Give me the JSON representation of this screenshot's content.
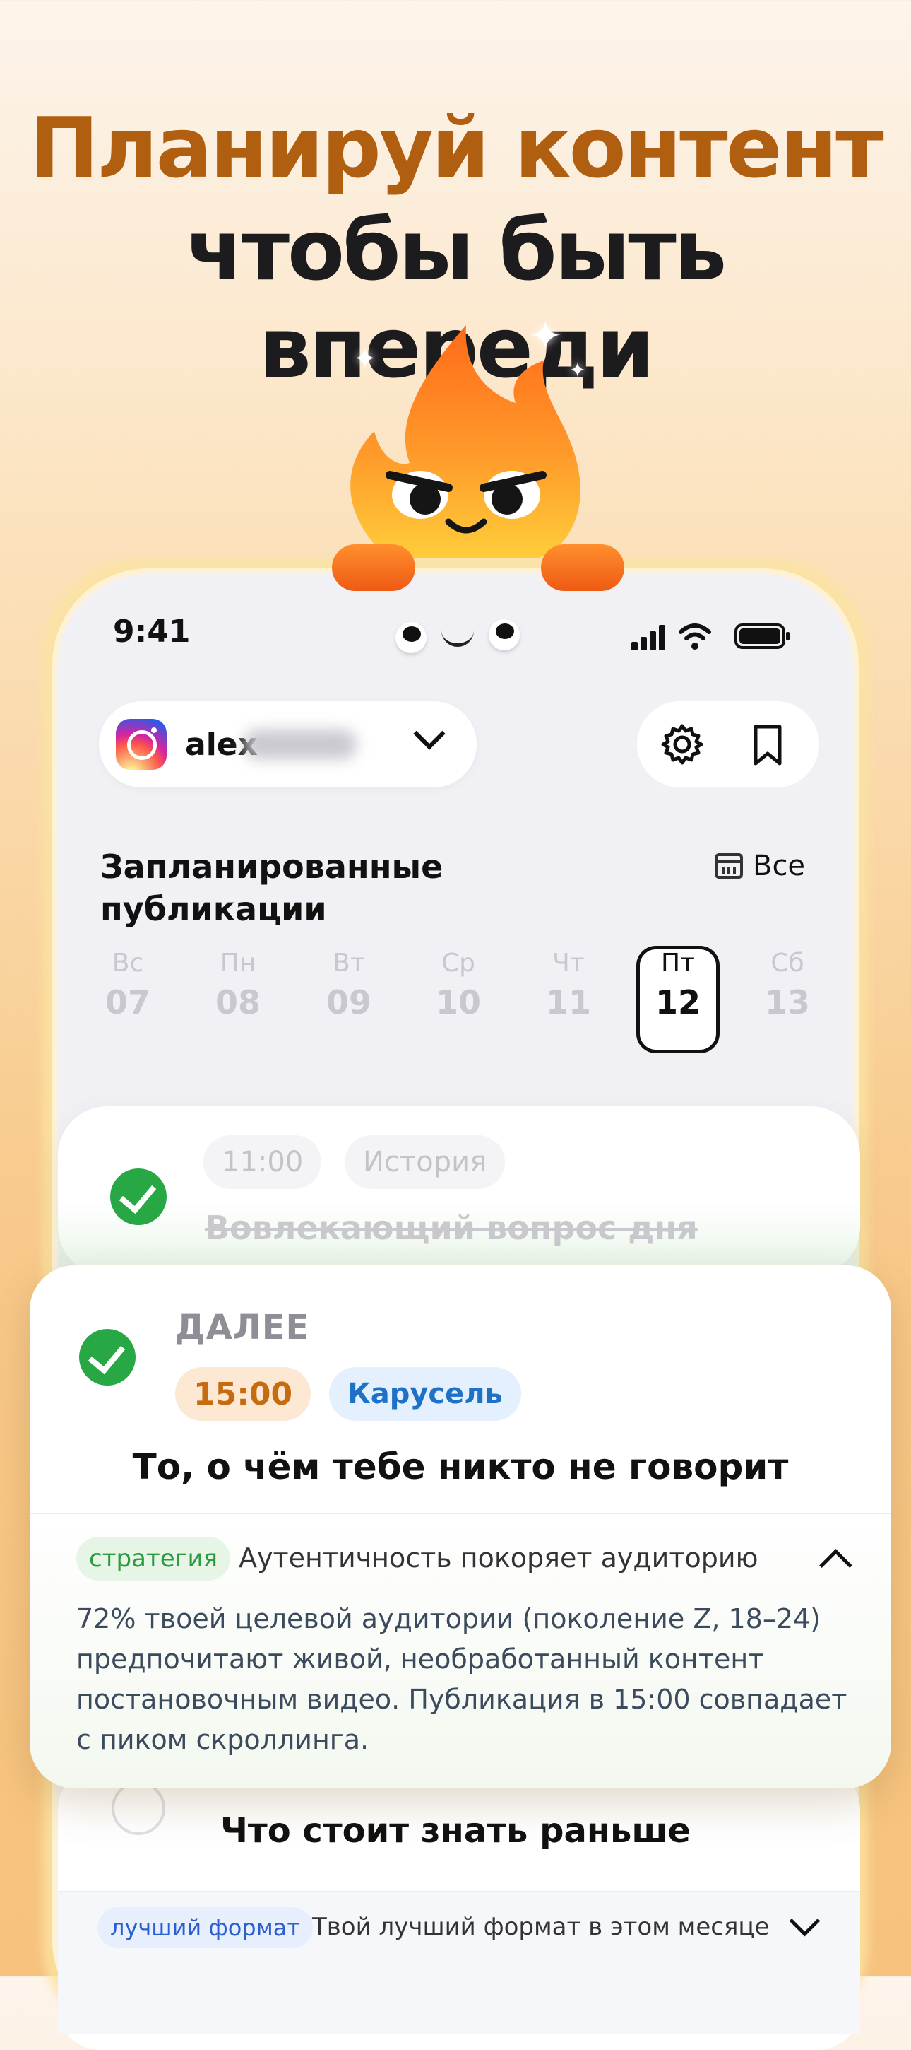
{
  "headline": {
    "line1": "Планируй контент",
    "line2": "чтобы быть впереди"
  },
  "colors": {
    "accent": "#b05f10",
    "success": "#27a844",
    "carousel": "#1d72c8",
    "time": "#c76b10"
  },
  "status_bar": {
    "time": "9:41"
  },
  "account": {
    "platform_icon": "instagram-icon",
    "name": "alex"
  },
  "toolbar": {
    "settings_icon": "gear-icon",
    "saved_icon": "bookmark-icon"
  },
  "section": {
    "title_line1": "Запланированные",
    "title_line2": "публикации",
    "filter_label": "Все"
  },
  "days": [
    {
      "name": "Вс",
      "date": "07"
    },
    {
      "name": "Пн",
      "date": "08"
    },
    {
      "name": "Вт",
      "date": "09"
    },
    {
      "name": "Ср",
      "date": "10"
    },
    {
      "name": "Чт",
      "date": "11"
    },
    {
      "name": "Пт",
      "date": "12"
    },
    {
      "name": "Сб",
      "date": "13"
    }
  ],
  "selected_day": "12",
  "posts": [
    {
      "time": "11:00",
      "type": "История",
      "title": "Вовлекающий вопрос дня",
      "done": true
    },
    {
      "label": "ДАЛЕЕ",
      "time": "15:00",
      "type": "Карусель",
      "title": "То, о чём тебе никто не говорит",
      "done": true,
      "insight_tag": "стратегия",
      "insight_title": "Аутентичность покоряет аудиторию",
      "insight_lines": [
        "72% твоей целевой аудитории (поколение Z, 18–24)",
        "предпочитают живой, необработанный контент",
        "постановочным видео. Публикация в 15:00 совпадает",
        "с пиком скроллинга."
      ]
    },
    {
      "title": "Что стоит знать раньше",
      "done": false,
      "insight_tag": "лучший формат",
      "insight_title": "Твой лучший формат в этом месяце"
    }
  ]
}
